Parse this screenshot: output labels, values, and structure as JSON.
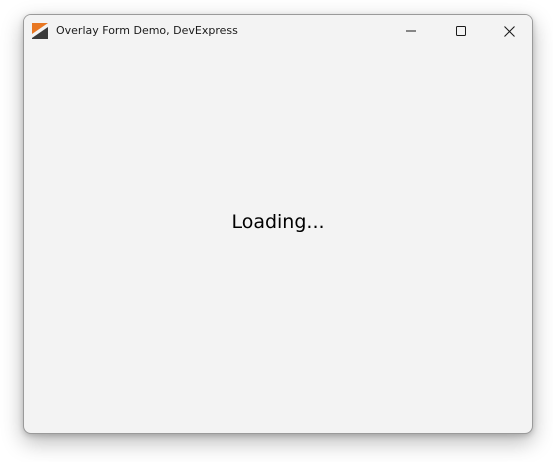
{
  "window": {
    "title": "Overlay Form Demo, DevExpress",
    "app_icon": "devexpress-logo-icon",
    "controls": {
      "minimize_icon": "minimize-icon",
      "maximize_icon": "maximize-icon",
      "close_icon": "close-icon"
    }
  },
  "overlay": {
    "loading_text": "Loading..."
  },
  "colors": {
    "logo_orange": "#e87722",
    "logo_dark": "#3a3a3a",
    "window_bg": "#f3f3f3"
  }
}
